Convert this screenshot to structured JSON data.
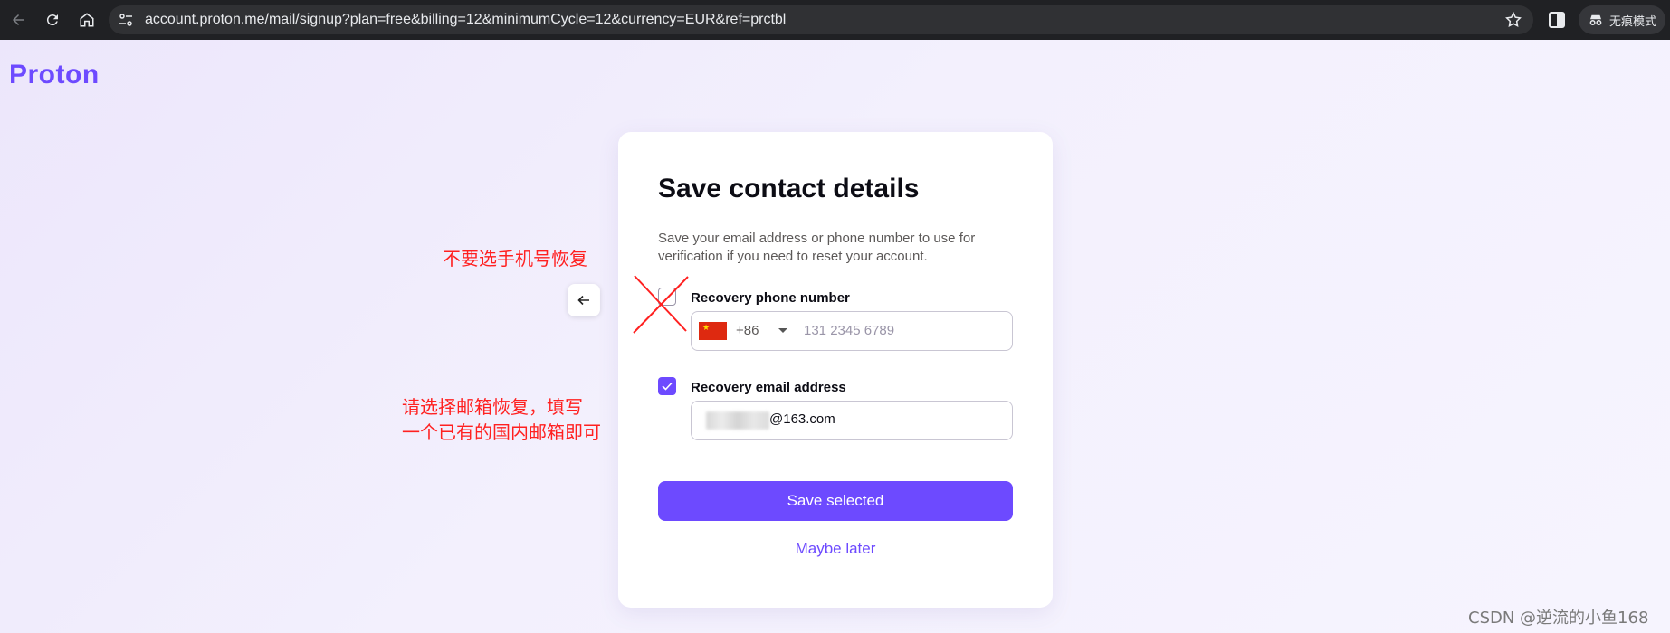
{
  "browser": {
    "url": "account.proton.me/mail/signup?plan=free&billing=12&minimumCycle=12&currency=EUR&ref=prctbl",
    "incognito_label": "无痕模式",
    "icons": [
      "back-arrow-icon",
      "reload-icon",
      "home-icon",
      "site-info-icon",
      "bookmark-star-icon",
      "side-panel-icon",
      "incognito-icon"
    ]
  },
  "logo": "Proton",
  "card": {
    "title": "Save contact details",
    "subtitle": "Save your email address or phone number to use for verification if you need to reset your account.",
    "phone": {
      "label": "Recovery phone number",
      "checked": false,
      "dial_code": "+86",
      "placeholder": "131 2345 6789"
    },
    "email": {
      "label": "Recovery email address",
      "checked": true,
      "value_suffix": "@163.com"
    },
    "save_label": "Save selected",
    "later_label": "Maybe later"
  },
  "annotations": {
    "phone_note": "不要选手机号恢复",
    "email_note_line1": "请选择邮箱恢复，填写",
    "email_note_line2": "一个已有的国内邮箱即可"
  },
  "watermark": "CSDN @逆流的小鱼168",
  "colors": {
    "accent": "#6d4aff",
    "annotation": "#ff2020"
  }
}
